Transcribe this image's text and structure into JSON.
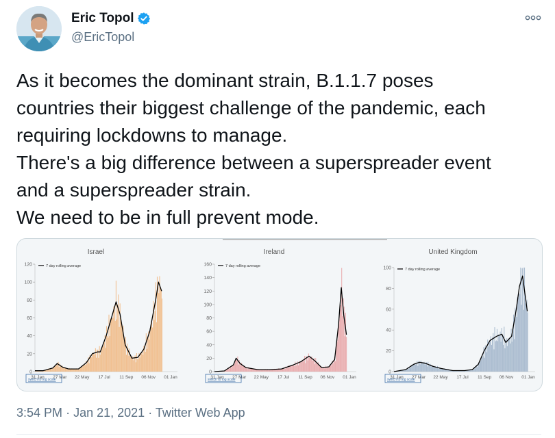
{
  "author": {
    "name": "Eric Topol",
    "handle": "@EricTopol",
    "verified": true,
    "verified_color": "#1da1f2"
  },
  "tweet": {
    "lines": [
      "As it becomes the dominant strain, B.1.1.7 poses",
      "countries their biggest challenge of the pandemic, each",
      "requiring lockdowns to manage.",
      "There's a big difference between a superspreader event",
      "and a superspreader strain.",
      "We need to be in full prevent mode."
    ]
  },
  "meta": {
    "time": "3:54 PM",
    "sep1": "·",
    "date": "Jan 21, 2021",
    "sep2": "·",
    "source": "Twitter Web App"
  },
  "icons": {
    "more": "more-icon",
    "verified": "verified-badge-icon"
  },
  "chart_data": [
    {
      "type": "bar",
      "title": "Israel",
      "legend": "7 day rolling average",
      "legend_position": "top-left",
      "ylim": [
        0,
        120
      ],
      "yticks": [
        0,
        20,
        40,
        60,
        80,
        100,
        120
      ],
      "xticks": [
        "31 Jan",
        "27 Mar",
        "22 May",
        "17 Jul",
        "11 Sep",
        "06 Nov",
        "01 Jan"
      ],
      "xlim": [
        0,
        360
      ],
      "bar_color": "#f0b67f",
      "line_color": "#000000",
      "toggle": "switch to log scale",
      "avg_points": [
        [
          0,
          1
        ],
        [
          20,
          1
        ],
        [
          45,
          4
        ],
        [
          56,
          9
        ],
        [
          70,
          5
        ],
        [
          85,
          3
        ],
        [
          110,
          3
        ],
        [
          130,
          10
        ],
        [
          145,
          20
        ],
        [
          158,
          22
        ],
        [
          165,
          22
        ],
        [
          180,
          40
        ],
        [
          192,
          58
        ],
        [
          205,
          78
        ],
        [
          215,
          64
        ],
        [
          228,
          30
        ],
        [
          245,
          15
        ],
        [
          260,
          16
        ],
        [
          275,
          25
        ],
        [
          290,
          45
        ],
        [
          305,
          80
        ],
        [
          312,
          100
        ],
        [
          320,
          90
        ]
      ]
    },
    {
      "type": "bar",
      "title": "Ireland",
      "legend": "7 day rolling average",
      "legend_position": "top-left",
      "ylim": [
        0,
        160
      ],
      "yticks": [
        0,
        20,
        40,
        60,
        80,
        100,
        120,
        140,
        160
      ],
      "xticks": [
        "31 Jan",
        "27 Mar",
        "22 May",
        "17 Jul",
        "11 Sep",
        "06 Nov",
        "01 Jan"
      ],
      "xlim": [
        0,
        360
      ],
      "bar_color": "#e8a2a4",
      "line_color": "#000000",
      "toggle": "switch to log scale",
      "avg_points": [
        [
          0,
          0
        ],
        [
          25,
          1
        ],
        [
          48,
          10
        ],
        [
          55,
          20
        ],
        [
          65,
          12
        ],
        [
          80,
          6
        ],
        [
          110,
          3
        ],
        [
          140,
          3
        ],
        [
          170,
          4
        ],
        [
          200,
          10
        ],
        [
          220,
          15
        ],
        [
          240,
          23
        ],
        [
          255,
          16
        ],
        [
          272,
          6
        ],
        [
          290,
          7
        ],
        [
          305,
          18
        ],
        [
          315,
          70
        ],
        [
          322,
          125
        ],
        [
          328,
          85
        ],
        [
          335,
          55
        ]
      ]
    },
    {
      "type": "bar",
      "title": "United Kingdom",
      "legend": "7 day rolling average",
      "legend_position": "top-left",
      "ylim": [
        0,
        100
      ],
      "yticks": [
        0,
        20,
        40,
        60,
        80,
        100
      ],
      "xticks": [
        "31 Jan",
        "27 Mar",
        "22 May",
        "17 Jul",
        "11 Sep",
        "06 Nov",
        "01 Jan"
      ],
      "xlim": [
        0,
        360
      ],
      "bar_color": "#9fb3c9",
      "line_color": "#000000",
      "toggle": "switch to log scale",
      "avg_points": [
        [
          0,
          0
        ],
        [
          30,
          2
        ],
        [
          50,
          7
        ],
        [
          65,
          9
        ],
        [
          80,
          8
        ],
        [
          100,
          5
        ],
        [
          120,
          3
        ],
        [
          150,
          1
        ],
        [
          180,
          1
        ],
        [
          200,
          2
        ],
        [
          215,
          7
        ],
        [
          230,
          20
        ],
        [
          245,
          30
        ],
        [
          262,
          34
        ],
        [
          275,
          36
        ],
        [
          285,
          28
        ],
        [
          300,
          34
        ],
        [
          312,
          60
        ],
        [
          320,
          82
        ],
        [
          328,
          92
        ],
        [
          334,
          75
        ],
        [
          340,
          58
        ]
      ]
    }
  ]
}
